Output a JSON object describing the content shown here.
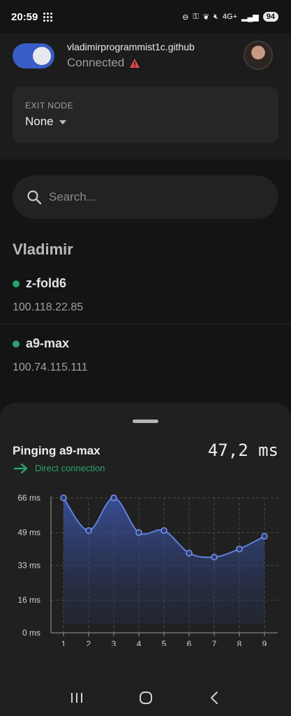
{
  "status_bar": {
    "time": "20:59",
    "network_label": "4G+",
    "battery": "94"
  },
  "header": {
    "account": "vladimirprogrammist1c.github",
    "status": "Connected"
  },
  "exit_node": {
    "label": "EXIT NODE",
    "value": "None"
  },
  "search": {
    "placeholder": "Search..."
  },
  "owner": {
    "name": "Vladimir"
  },
  "devices": [
    {
      "name": "z-fold6",
      "ip": "100.118.22.85",
      "online_color": "#26a26b"
    },
    {
      "name": "a9-max",
      "ip": "100.74.115.111",
      "online_color": "#26a26b"
    }
  ],
  "ping_sheet": {
    "title": "Pinging a9-max",
    "latency": "47,2 ms",
    "connection": "Direct connection"
  },
  "colors": {
    "accent": "#3a5cc5",
    "line": "#5f7fe0",
    "online": "#26a26b"
  },
  "chart_data": {
    "type": "area",
    "x": [
      1,
      2,
      3,
      4,
      5,
      6,
      7,
      8,
      9
    ],
    "series": [
      {
        "values": [
          66,
          50,
          66,
          49,
          50,
          39,
          37,
          41,
          47.2
        ]
      }
    ],
    "yticks": [
      "0 ms",
      "16 ms",
      "33 ms",
      "49 ms",
      "66 ms"
    ],
    "ytick_values": [
      0,
      16,
      33,
      49,
      66
    ],
    "ylim": [
      0,
      66
    ],
    "xlim": [
      1,
      9
    ],
    "grid": true,
    "legend": "none"
  }
}
